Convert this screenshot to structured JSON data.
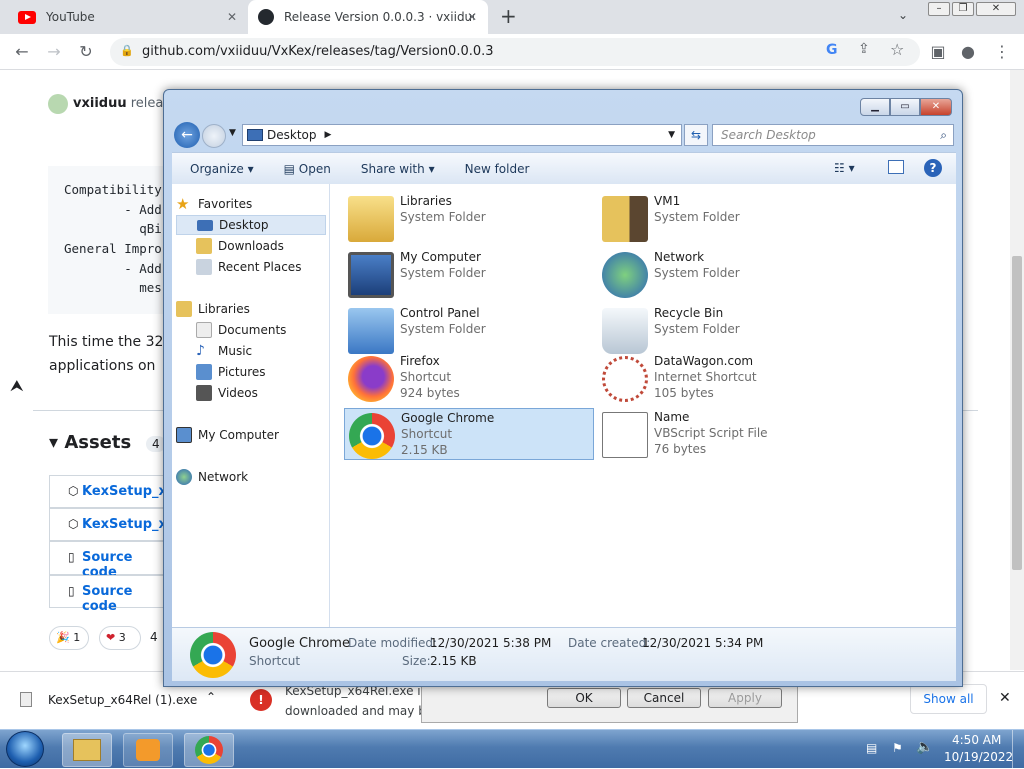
{
  "browser": {
    "tabs": [
      {
        "title": "YouTube"
      },
      {
        "title": "Release Version 0.0.0.3 · vxiiduu/"
      }
    ],
    "new_tab": "+",
    "url": "github.com/vxiiduu/VxKex/releases/tag/Version0.0.0.3"
  },
  "github": {
    "author": "vxiiduu",
    "author_suffix": "release",
    "code_lines": [
      "Compatibility",
      "        - Add",
      "          qBi",
      "General Impro",
      "        - Add",
      "          mes"
    ],
    "paragraph_line1": "This time the 32",
    "paragraph_line2": "applications on",
    "assets_heading": "Assets",
    "assets_count": "4",
    "assets": [
      {
        "label": "KexSetup_x6"
      },
      {
        "label": "KexSetup_x6"
      },
      {
        "label": "Source code"
      },
      {
        "label": "Source code"
      }
    ],
    "reactions": [
      {
        "emoji": "🎉",
        "count": "1"
      },
      {
        "emoji": "❤",
        "count": "3"
      },
      {
        "emoji": "",
        "count": "4"
      }
    ]
  },
  "download_bar": {
    "file": "KexSetup_x64Rel (1).exe",
    "warning_line1": "KexSetup_x64Rel.exe is",
    "warning_line2": "downloaded and may b",
    "show_all": "Show all"
  },
  "dialog_buttons": {
    "ok": "OK",
    "cancel": "Cancel",
    "apply": "Apply"
  },
  "explorer": {
    "location": "Desktop",
    "search_placeholder": "Search Desktop",
    "commands": [
      "Organize",
      "Open",
      "Share with",
      "New folder"
    ],
    "nav": {
      "favorites": "Favorites",
      "fav_items": [
        "Desktop",
        "Downloads",
        "Recent Places"
      ],
      "libraries": "Libraries",
      "lib_items": [
        "Documents",
        "Music",
        "Pictures",
        "Videos"
      ],
      "computer": "My Computer",
      "network": "Network"
    },
    "items": [
      {
        "name": "Libraries",
        "type": "System Folder",
        "size": ""
      },
      {
        "name": "VM1",
        "type": "System Folder",
        "size": ""
      },
      {
        "name": "My Computer",
        "type": "System Folder",
        "size": ""
      },
      {
        "name": "Network",
        "type": "System Folder",
        "size": ""
      },
      {
        "name": "Control Panel",
        "type": "System Folder",
        "size": ""
      },
      {
        "name": "Recycle Bin",
        "type": "System Folder",
        "size": ""
      },
      {
        "name": "Firefox",
        "type": "Shortcut",
        "size": "924 bytes"
      },
      {
        "name": "DataWagon.com",
        "type": "Internet Shortcut",
        "size": "105 bytes"
      },
      {
        "name": "Google Chrome",
        "type": "Shortcut",
        "size": "2.15 KB"
      },
      {
        "name": "Name",
        "type": "VBScript Script File",
        "size": "76 bytes"
      }
    ],
    "details": {
      "name": "Google Chrome",
      "type": "Shortcut",
      "modified_label": "Date modified:",
      "modified": "12/30/2021 5:38 PM",
      "created_label": "Date created:",
      "created": "12/30/2021 5:34 PM",
      "size_label": "Size:",
      "size": "2.15 KB"
    }
  },
  "taskbar": {
    "time": "4:50 AM",
    "date": "10/19/2022"
  }
}
